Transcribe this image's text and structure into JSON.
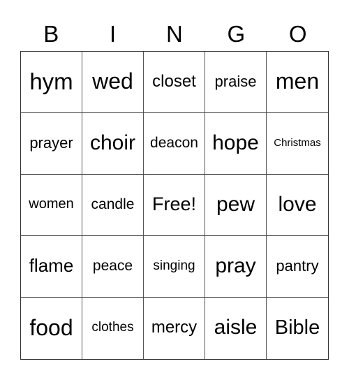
{
  "header": [
    "B",
    "I",
    "N",
    "G",
    "O"
  ],
  "cells": [
    "hym",
    "wed",
    "closet",
    "praise",
    "men",
    "prayer",
    "choir",
    "deacon",
    "hope",
    "Christmas",
    "women",
    "candle",
    "Free!",
    "pew",
    "love",
    "flame",
    "peace",
    "singing",
    "pray",
    "pantry",
    "food",
    "clothes",
    "mercy",
    "aisle",
    "Bible"
  ]
}
